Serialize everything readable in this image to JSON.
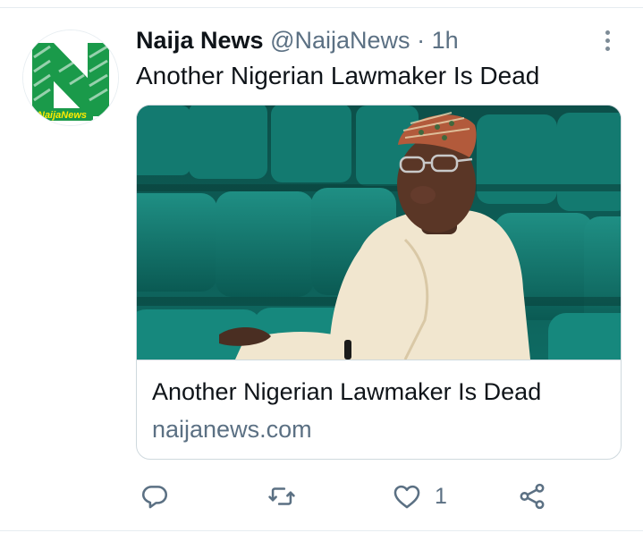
{
  "tweet": {
    "author_name": "Naija News",
    "author_handle": "@NaijaNews",
    "separator": "·",
    "time": "1h",
    "text": "Another Nigerian Lawmaker Is Dead",
    "avatar": {
      "logo_text": "NaijaNews",
      "brand_color": "#1a9a4a"
    }
  },
  "card": {
    "title": "Another Nigerian Lawmaker Is Dead",
    "domain": "naijanews.com",
    "image_description_icon": "lawmaker-photo"
  },
  "actions": {
    "reply_icon": "reply-icon",
    "retweet_icon": "retweet-icon",
    "like_icon": "heart-icon",
    "like_count": "1",
    "share_icon": "share-icon",
    "icon_color": "#5b7083"
  }
}
